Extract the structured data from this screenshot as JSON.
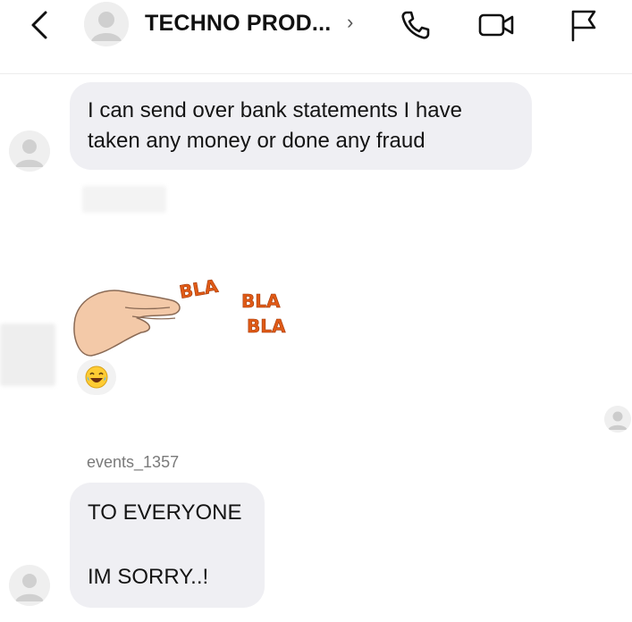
{
  "header": {
    "title": "TECHNO PROD...",
    "chevron": "›",
    "icons": [
      "back-chevron-icon",
      "phone-icon",
      "video-camera-icon",
      "flag-icon"
    ]
  },
  "messages": [
    {
      "text_line1": "I can send over bank statements I have",
      "text_line2": "taken any money or done any fraud"
    },
    {
      "sticker_words": [
        "BLA",
        "BLA",
        "BLA"
      ],
      "reaction_icon": "laughing-emoji-icon"
    },
    {
      "sender": "events_1357",
      "text_line1": "TO EVERYONE",
      "text_line2": "IM SORRY..!"
    }
  ],
  "colors": {
    "bubble": "#efeff3",
    "sticker_text": "#e05a16",
    "hand": "#f3c9a8"
  }
}
